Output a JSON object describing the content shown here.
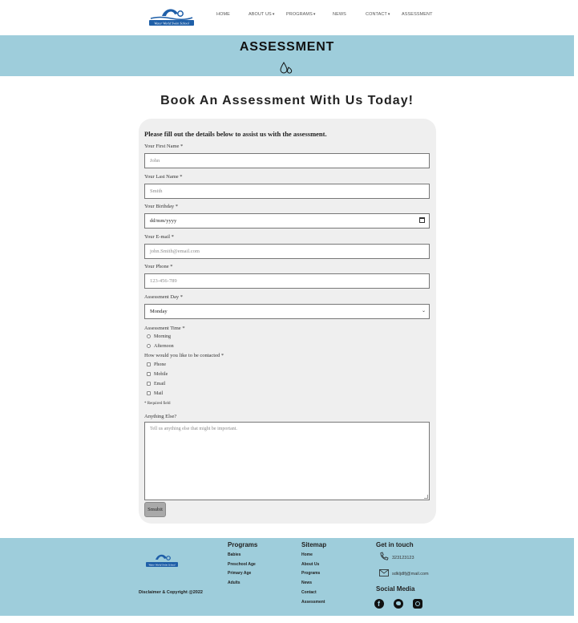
{
  "nav": {
    "logo_text": "Water World Swim School",
    "items": [
      {
        "label": "HOME",
        "dropdown": false
      },
      {
        "label": "ABOUT US",
        "dropdown": true
      },
      {
        "label": "PROGRAMS",
        "dropdown": true
      },
      {
        "label": "NEWS",
        "dropdown": false
      },
      {
        "label": "CONTACT",
        "dropdown": true
      },
      {
        "label": "ASSESSMENT",
        "dropdown": false
      }
    ],
    "dropdown_glyph": "▾"
  },
  "banner": {
    "title": "ASSESSMENT",
    "icon": "water-drops-icon"
  },
  "heading": "Book An Assessment With Us Today!",
  "form": {
    "intro": "Please fill out the details below to assist us with the assessment.",
    "first_name": {
      "label": "Your First Name *",
      "placeholder": "John"
    },
    "last_name": {
      "label": "Your Last Name *",
      "placeholder": "Smith"
    },
    "birthday": {
      "label": "Your Birthday *",
      "value": "dd/mm/yyyy"
    },
    "email": {
      "label": "Your E-mail *",
      "placeholder": "john.Smith@email.com"
    },
    "phone": {
      "label": "Your Phone *",
      "placeholder": "123-456-789"
    },
    "day": {
      "label": "Assessment Day *",
      "value": "Monday"
    },
    "time": {
      "label": "Assessment Time *",
      "options": [
        "Morning",
        "Afternoon"
      ]
    },
    "contact": {
      "label": "How would you like to be contacted *",
      "options": [
        "Phone",
        "Mobile",
        "Email",
        "Mail"
      ]
    },
    "required_note": "* Required field",
    "anything": {
      "label": "Anything Else?",
      "placeholder": "Tell us anything else that might be important."
    },
    "submit": "Smubit"
  },
  "footer": {
    "logo_text": "Water World Swim School",
    "copyright": "Disclaimer & Copyright @2022",
    "programs": {
      "heading": "Programs",
      "links": [
        "Babies",
        "Preschool Age",
        "Primary Age",
        "Adults"
      ]
    },
    "sitemap": {
      "heading": "Sitemap",
      "links": [
        "Home",
        "About Us",
        "Programs",
        "News",
        "Contact",
        "Assessment"
      ]
    },
    "contact": {
      "heading": "Get in touch",
      "phone": "323123123",
      "email": "sdkljdlfj@mail.com"
    },
    "social": {
      "heading": "Social Media",
      "icons": [
        "facebook-icon",
        "twitter-icon",
        "instagram-icon"
      ]
    }
  },
  "colors": {
    "band": "#9ecddb",
    "card": "#efefef",
    "submit": "#a9a9a9",
    "logo_blue": "#1f5fa8"
  }
}
